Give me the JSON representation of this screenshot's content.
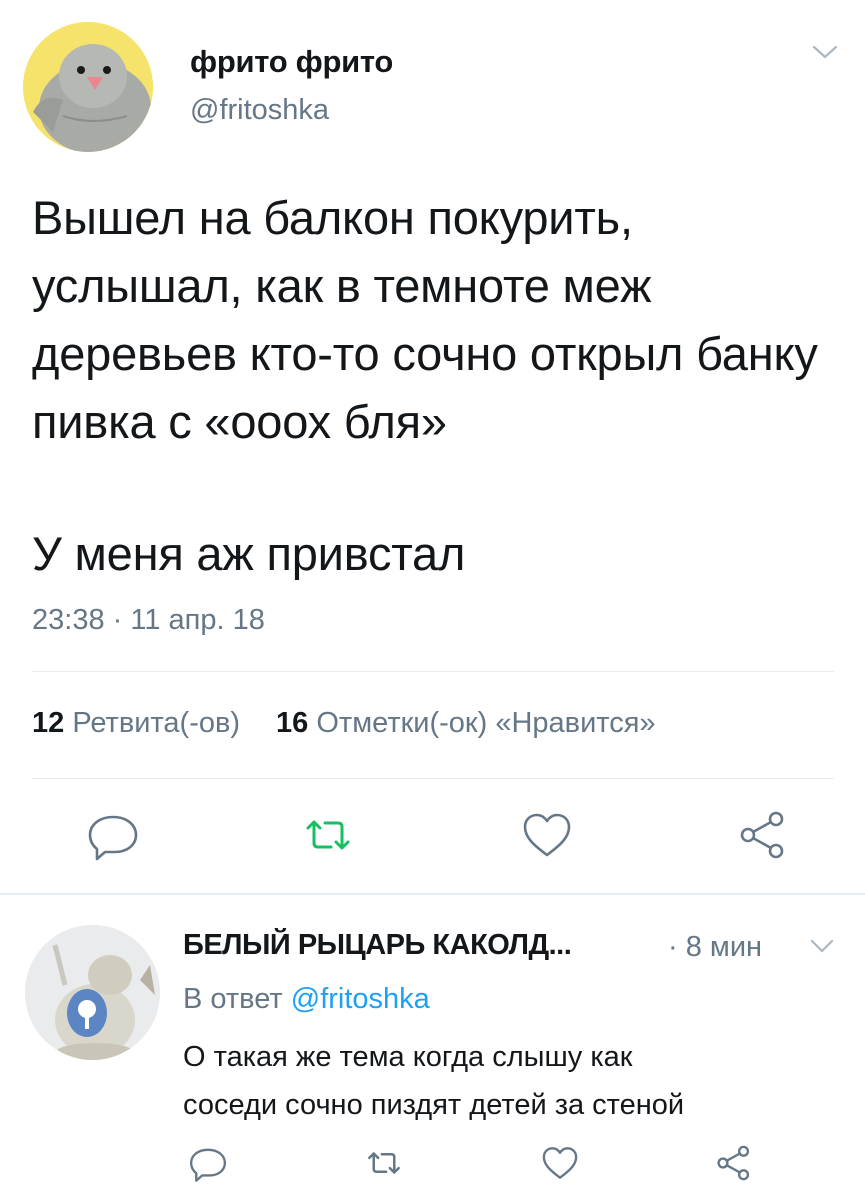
{
  "tweet": {
    "author_name": "фрито фрито",
    "author_handle": "@fritoshka",
    "text_lines": [
      "Вышел на балкон покурить, услышал, как в темноте меж деревьев кто-то сочно открыл банку пивка с «ооох бля»",
      "У меня аж привстал"
    ],
    "timestamp": "23:38 · 11 апр. 18",
    "retweets_count": "12",
    "retweets_label": "Ретвита(-ов)",
    "likes_count": "16",
    "likes_label": "Отметки(-ок) «Нравится»",
    "icons": {
      "menu": "chevron-down-icon",
      "reply": "reply-icon",
      "retweet": "retweet-icon",
      "like": "heart-icon",
      "share": "share-icon"
    },
    "colors": {
      "retweet_active": "#17bf63",
      "icon_gray": "#657786",
      "text": "#14171a",
      "secondary": "#657786"
    }
  },
  "reply": {
    "author_name": "БЕЛЫЙ РЫЦАРЬ КАКОЛД...",
    "time": "· 8 мин",
    "reply_prefix": "В ответ",
    "reply_handle": "@fritoshka",
    "text_lines": [
      "О такая же тема когда слышу как",
      "соседи сочно пиздят детей за стеной"
    ],
    "colors": {
      "link": "#1da1f2"
    }
  }
}
